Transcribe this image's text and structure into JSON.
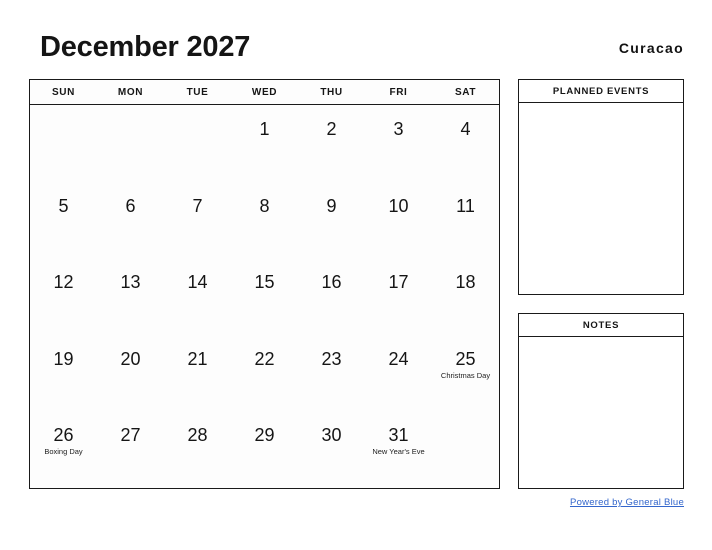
{
  "header": {
    "title": "December 2027",
    "location": "Curacao"
  },
  "calendar": {
    "weekdays": [
      "SUN",
      "MON",
      "TUE",
      "WED",
      "THU",
      "FRI",
      "SAT"
    ],
    "weeks": [
      [
        {
          "day": ""
        },
        {
          "day": ""
        },
        {
          "day": ""
        },
        {
          "day": "1"
        },
        {
          "day": "2"
        },
        {
          "day": "3"
        },
        {
          "day": "4"
        }
      ],
      [
        {
          "day": "5"
        },
        {
          "day": "6"
        },
        {
          "day": "7"
        },
        {
          "day": "8"
        },
        {
          "day": "9"
        },
        {
          "day": "10"
        },
        {
          "day": "11"
        }
      ],
      [
        {
          "day": "12"
        },
        {
          "day": "13"
        },
        {
          "day": "14"
        },
        {
          "day": "15"
        },
        {
          "day": "16"
        },
        {
          "day": "17"
        },
        {
          "day": "18"
        }
      ],
      [
        {
          "day": "19"
        },
        {
          "day": "20"
        },
        {
          "day": "21"
        },
        {
          "day": "22"
        },
        {
          "day": "23"
        },
        {
          "day": "24"
        },
        {
          "day": "25",
          "event": "Christmas Day"
        }
      ],
      [
        {
          "day": "26",
          "event": "Boxing Day"
        },
        {
          "day": "27"
        },
        {
          "day": "28"
        },
        {
          "day": "29"
        },
        {
          "day": "30"
        },
        {
          "day": "31",
          "event": "New Year's Eve"
        },
        {
          "day": ""
        }
      ]
    ]
  },
  "panels": {
    "planned_events": {
      "title": "PLANNED EVENTS",
      "content": ""
    },
    "notes": {
      "title": "NOTES",
      "content": ""
    }
  },
  "footer": {
    "link_label": "Powered by General Blue",
    "link_color": "#3366cc"
  }
}
